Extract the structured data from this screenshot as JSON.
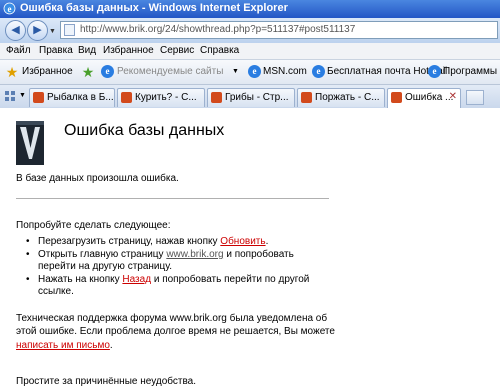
{
  "window": {
    "title": "Ошибка базы данных - Windows Internet Explorer"
  },
  "address": {
    "url": "http://www.brik.org/24/showthread.php?p=511137#post511137"
  },
  "menu": [
    "Файл",
    "Правка",
    "Вид",
    "Избранное",
    "Сервис",
    "Справка"
  ],
  "favbar": {
    "favorites": "Избранное",
    "recommended": "Рекомендуемые сайты",
    "links": [
      "MSN.com",
      "Бесплатная почта Hotmail",
      "Программы р"
    ]
  },
  "tabs": [
    {
      "label": "Рыбалка в Б..."
    },
    {
      "label": "Курить? - С..."
    },
    {
      "label": "Грибы - Стр..."
    },
    {
      "label": "Поржать - С..."
    },
    {
      "label": "Ошибка ..."
    }
  ],
  "page": {
    "title": "Ошибка базы данных",
    "error_line": "В базе данных произошла ошибка.",
    "try_heading": "Попробуйте сделать следующее:",
    "tip1_text": "Перезагрузить страницу, нажав кнопку ",
    "tip1_link": "Обновить",
    "tip1_end": ".",
    "tip2_text1": "Открыть главную страницу ",
    "tip2_link": "www.brik.org",
    "tip2_text2": " и попробовать",
    "tip2_text3": "перейти на другую страницу.",
    "tip3_text1": "Нажать на кнопку ",
    "tip3_link": "Назад",
    "tip3_text2": " и попробовать перейти по другой",
    "tip3_text3": "ссылке.",
    "support_line1": "Техническая поддержка форума www.brik.org была уведомлена об",
    "support_line2": "этой ошибке. Если проблема долгое время не решается, Вы можете",
    "support_link": "написать им письмо",
    "support_end": ".",
    "apology": "Простите за причинённые неудобства."
  }
}
